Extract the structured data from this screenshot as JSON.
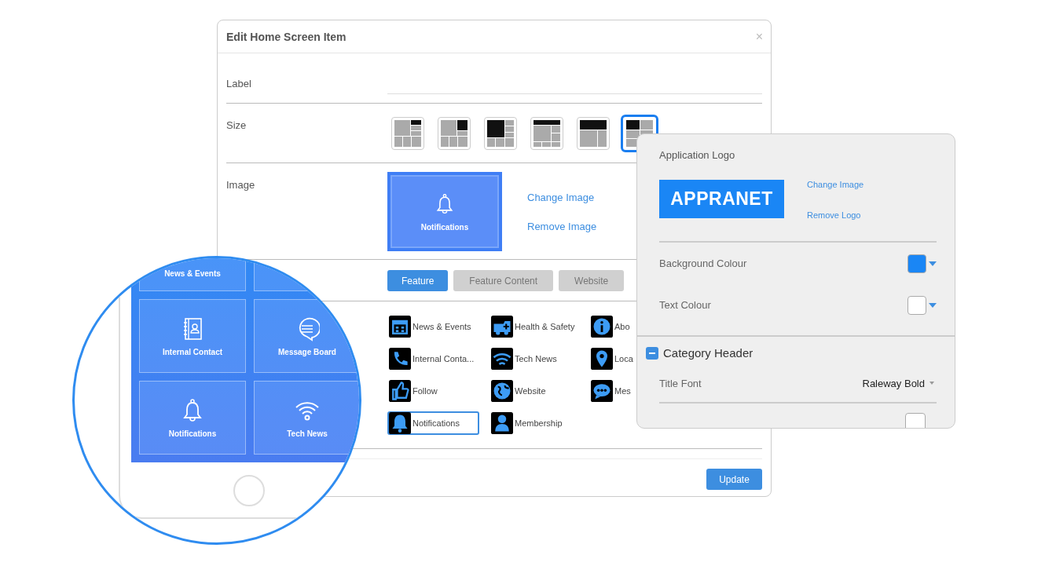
{
  "dialog": {
    "title": "Edit Home Screen Item",
    "close": "×",
    "label_row": {
      "label": "Label"
    },
    "size_row": {
      "label": "Size",
      "options": [
        {
          "selected": false
        },
        {
          "selected": false
        },
        {
          "selected": false
        },
        {
          "selected": false
        },
        {
          "selected": false
        },
        {
          "selected": true
        }
      ]
    },
    "image_row": {
      "label": "Image",
      "preview_label": "Notifications",
      "links": [
        "Change Image",
        "Remove Image"
      ]
    },
    "tabs": [
      {
        "label": "Feature",
        "selected": true
      },
      {
        "label": "Feature Content",
        "selected": false
      },
      {
        "label": "Website",
        "selected": false
      }
    ],
    "features": [
      {
        "label": "News & Events",
        "selected": false
      },
      {
        "label": "Health & Safety",
        "selected": false
      },
      {
        "label": "Abo",
        "selected": false
      },
      {
        "label": "Internal Conta...",
        "selected": false
      },
      {
        "label": "Tech News",
        "selected": false
      },
      {
        "label": "Loca",
        "selected": false
      },
      {
        "label": "Follow",
        "selected": false
      },
      {
        "label": "Website",
        "selected": false
      },
      {
        "label": "Mes",
        "selected": false
      },
      {
        "label": "Notifications",
        "selected": true
      },
      {
        "label": "Membership",
        "selected": false
      }
    ],
    "update_button": "Update"
  },
  "logo_panel": {
    "title": "Application Logo",
    "logo_text": "APPRANET",
    "links": [
      "Change Image",
      "Remove Logo"
    ],
    "colours": [
      {
        "label": "Background Colour",
        "color": "#1a86f5"
      },
      {
        "label": "Text Colour",
        "color": "#ffffff"
      }
    ],
    "category": {
      "title": "Category Header",
      "expanded": true,
      "title_font": {
        "label": "Title Font",
        "value": "Raleway Bold"
      }
    }
  },
  "magnifier": {
    "tiles": [
      {
        "label": "News & Events"
      },
      {
        "label": "Internal Contact"
      },
      {
        "label": "Message Board"
      },
      {
        "label": "Notifications"
      },
      {
        "label": "Tech News"
      }
    ]
  }
}
